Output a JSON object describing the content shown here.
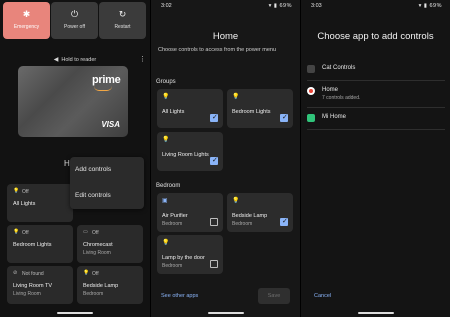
{
  "power_menu": {
    "buttons": [
      {
        "label": "Emergency",
        "icon": "asterisk-icon",
        "color": "#e8857c"
      },
      {
        "label": "Power off",
        "icon": "power-icon"
      },
      {
        "label": "Restart",
        "icon": "restart-icon"
      }
    ],
    "hold_to_reader": "Hold to reader",
    "card": {
      "brand": "prime",
      "network": "VISA"
    },
    "heading_fragment": "H",
    "popup_menu": [
      "Add controls",
      "Edit controls"
    ],
    "tiles": [
      {
        "status": "Off",
        "name": "All Lights",
        "room": ""
      },
      {
        "status": "Off",
        "name": "Bedroom Lights",
        "room": ""
      },
      {
        "status": "Off",
        "name": "Chromecast",
        "room": "Living Room"
      },
      {
        "status": "Not found",
        "name": "Living Room TV",
        "room": "Living Room"
      },
      {
        "status": "Off",
        "name": "Bedside Lamp",
        "room": "Bedroom"
      }
    ]
  },
  "home_screen": {
    "status_time": "3:02",
    "status_battery": "69%",
    "title": "Home",
    "subtitle": "Choose controls to access from the power menu",
    "groups_label": "Groups",
    "groups": [
      {
        "name": "All Lights",
        "room": "",
        "checked": true
      },
      {
        "name": "Bedroom Lights",
        "room": "",
        "checked": true
      },
      {
        "name": "Living Room Lights",
        "room": "",
        "checked": true
      }
    ],
    "bedroom_label": "Bedroom",
    "bedroom": [
      {
        "name": "Air Purifier",
        "room": "Bedroom",
        "checked": false
      },
      {
        "name": "Bedside Lamp",
        "room": "Bedroom",
        "checked": true
      },
      {
        "name": "Lamp by the door",
        "room": "Bedroom",
        "checked": false
      }
    ],
    "see_other_apps": "See other apps",
    "save": "Save"
  },
  "choose_app": {
    "status_time": "3:03",
    "status_battery": "69%",
    "title": "Choose app to add controls",
    "apps": [
      {
        "name": "Cat Controls",
        "sub": ""
      },
      {
        "name": "Home",
        "sub": "7 controls added."
      },
      {
        "name": "Mi Home",
        "sub": ""
      }
    ],
    "cancel": "Cancel"
  },
  "colors": {
    "accent": "#8ab4f8",
    "bulb": "#f4c24e",
    "emergency": "#e8857c"
  }
}
